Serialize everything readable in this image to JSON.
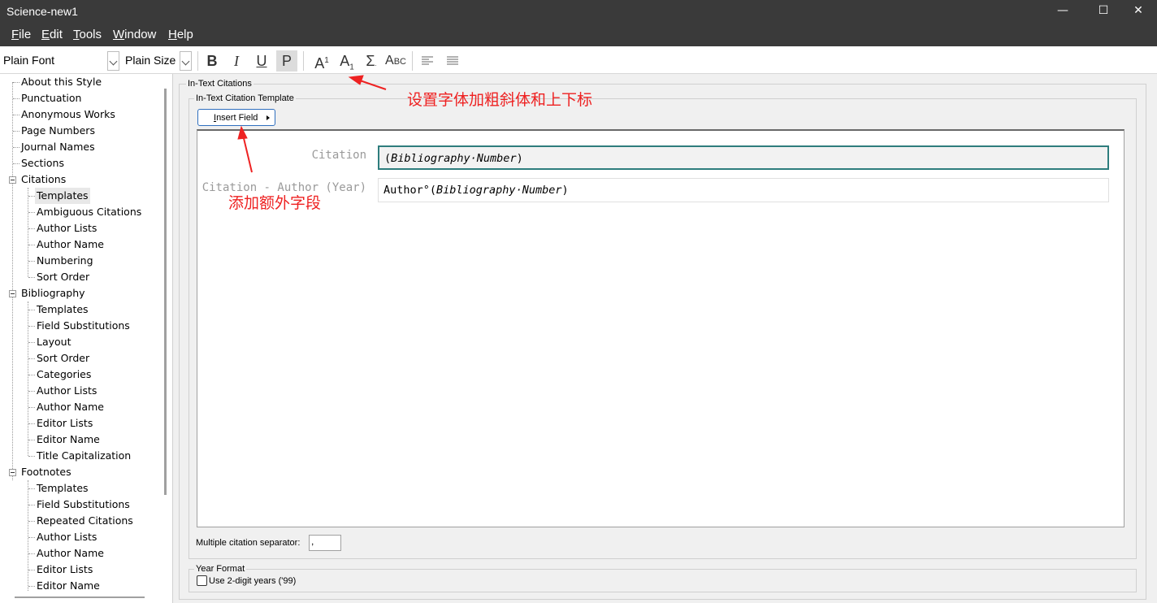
{
  "window": {
    "title": "Science-new1",
    "minimize_glyph": "—",
    "maximize_glyph": "☐",
    "close_glyph": "✕"
  },
  "menu": [
    {
      "accel": "F",
      "rest": "ile"
    },
    {
      "accel": "E",
      "rest": "dit"
    },
    {
      "accel": "T",
      "rest": "ools"
    },
    {
      "accel": "W",
      "rest": "indow"
    },
    {
      "accel": "H",
      "rest": "elp"
    }
  ],
  "toolbar": {
    "font_combo": "Plain Font",
    "size_combo": "Plain Size",
    "bold": "B",
    "italic": "I",
    "underline": "U",
    "plain": "P",
    "superscript": "A",
    "superscript_mark": "1",
    "subscript": "A",
    "subscript_mark": "1",
    "symbol": "Σ",
    "smallcaps": "A",
    "smallcaps_rest": "BC"
  },
  "tree": {
    "items": [
      "About this Style",
      "Punctuation",
      "Anonymous Works",
      "Page Numbers",
      "Journal Names",
      "Sections",
      "Citations",
      "Templates",
      "Ambiguous Citations",
      "Author Lists",
      "Author Name",
      "Numbering",
      "Sort Order",
      "Bibliography",
      "Templates",
      "Field Substitutions",
      "Layout",
      "Sort Order",
      "Categories",
      "Author Lists",
      "Author Name",
      "Editor Lists",
      "Editor Name",
      "Title Capitalization",
      "Footnotes",
      "Templates",
      "Field Substitutions",
      "Repeated Citations",
      "Author Lists",
      "Author Name",
      "Editor Lists",
      "Editor Name"
    ]
  },
  "main": {
    "group_title": "In-Text Citations",
    "template_group_title": "In-Text Citation Template",
    "insert_field_label": "Insert Field",
    "rows": [
      {
        "label": "Citation",
        "prefix": "(",
        "italic": "Bibliography·Number",
        "suffix": ")"
      },
      {
        "label": "Citation - Author (Year)",
        "prefix": "Author°(",
        "italic": "Bibliography·Number",
        "suffix": ")"
      }
    ],
    "separator_label": "Multiple citation separator:",
    "separator_value": ",",
    "year_group_title": "Year Format",
    "year_checkbox_label": "Use 2-digit years ('99)"
  },
  "annotations": {
    "toolbar_note": "设置字体加粗斜体和上下标",
    "insert_note": "添加额外字段"
  },
  "colors": {
    "titlebar": "#3a3a3a",
    "focus_border": "#2e7d7d",
    "annotation": "#ee2222"
  }
}
